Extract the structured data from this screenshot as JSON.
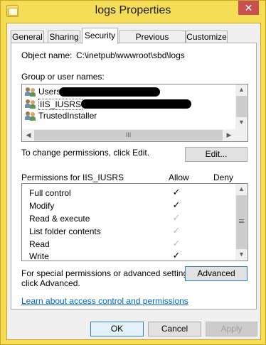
{
  "window": {
    "title": "logs Properties",
    "close_glyph": "✕"
  },
  "tabs": [
    {
      "label": "General"
    },
    {
      "label": "Sharing"
    },
    {
      "label": "Security"
    },
    {
      "label": "Previous Versions"
    },
    {
      "label": "Customize"
    }
  ],
  "security": {
    "object_name_label": "Object name:",
    "object_name_value": "C:\\inetpub\\wwwroot\\sbd\\logs",
    "group_label": "Group or user names:",
    "users": [
      {
        "name": "Users",
        "icon": "users-group-icon"
      },
      {
        "name": "IIS_IUSRS",
        "icon": "users-group-icon"
      },
      {
        "name": "TrustedInstaller",
        "icon": "users-group-icon"
      }
    ],
    "hscroll_thumb_glyph": "III",
    "change_text": "To change permissions, click Edit.",
    "edit_button": "Edit...",
    "permissions_label": "Permissions for IIS_IUSRS",
    "allow_header": "Allow",
    "deny_header": "Deny",
    "permissions": [
      {
        "name": "Full control",
        "allow": "✓",
        "allow_state": "checked"
      },
      {
        "name": "Modify",
        "allow": "✓",
        "allow_state": "checked"
      },
      {
        "name": "Read & execute",
        "allow": "✓",
        "allow_state": "inherited"
      },
      {
        "name": "List folder contents",
        "allow": "✓",
        "allow_state": "inherited"
      },
      {
        "name": "Read",
        "allow": "✓",
        "allow_state": "inherited"
      },
      {
        "name": "Write",
        "allow": "✓",
        "allow_state": "checked"
      }
    ],
    "special_text_line1": "For special permissions or advanced settings,",
    "special_text_line2": "click Advanced.",
    "advanced_button": "Advanced",
    "learn_link": "Learn about access control and permissions"
  },
  "footer": {
    "ok": "OK",
    "cancel": "Cancel",
    "apply": "Apply"
  },
  "colors": {
    "title_bar": "#f6dd58",
    "close_button": "#c75050",
    "link": "#0066cc"
  }
}
